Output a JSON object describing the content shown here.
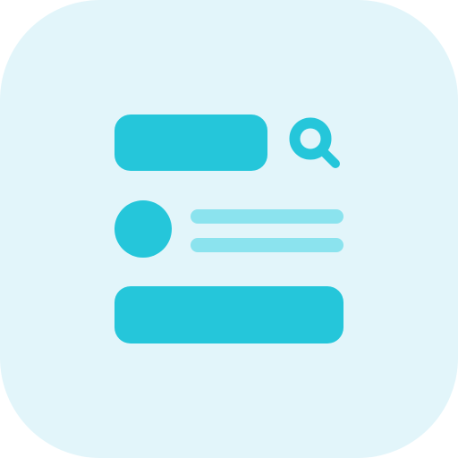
{
  "icon": {
    "name": "search-list-icon",
    "background_color": "#e2f5fa",
    "primary_color": "#25c6da",
    "secondary_color": "#8be3ee",
    "elements": {
      "search_bar": "search-bar-shape",
      "search_icon": "magnifying-glass-icon",
      "list_item": {
        "avatar": "avatar-circle",
        "lines": [
          "text-line",
          "text-line"
        ]
      },
      "bottom_bar": "button-bar-shape"
    }
  }
}
